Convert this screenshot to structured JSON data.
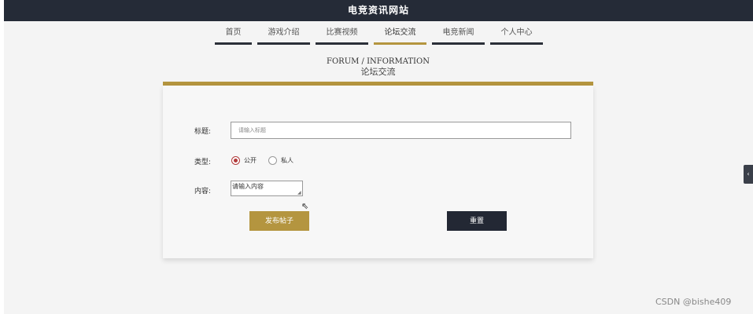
{
  "site": {
    "title": "电竞资讯网站"
  },
  "nav": [
    {
      "label": "首页",
      "active": false
    },
    {
      "label": "游戏介绍",
      "active": false
    },
    {
      "label": "比赛视频",
      "active": false
    },
    {
      "label": "论坛交流",
      "active": true
    },
    {
      "label": "电竞新闻",
      "active": false
    },
    {
      "label": "个人中心",
      "active": false
    }
  ],
  "heading": {
    "en": "FORUM / INFORMATION",
    "cn": "论坛交流"
  },
  "form": {
    "title_label": "标题:",
    "title_placeholder": "请输入标题",
    "type_label": "类型:",
    "type_options": [
      {
        "label": "公开",
        "checked": true
      },
      {
        "label": "私人",
        "checked": false
      }
    ],
    "content_label": "内容:",
    "content_placeholder": "请输入内容",
    "submit_label": "发布帖子",
    "reset_label": "重置"
  },
  "side_tab": {
    "icon": "chevron-left-icon",
    "glyph": "‹"
  },
  "watermark": "CSDN @bishe409",
  "colors": {
    "accent": "#b4953f",
    "dark": "#232834",
    "radio": "#b13a3a"
  }
}
